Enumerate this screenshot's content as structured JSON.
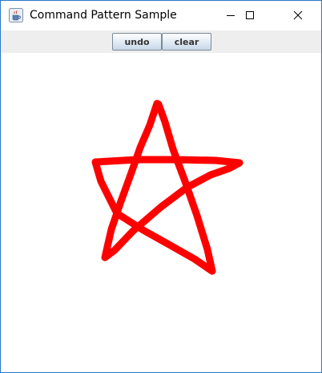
{
  "window": {
    "title": "Command Pattern Sample",
    "app_icon": "java-cup-icon",
    "controls": {
      "minimize_icon": "minimize-icon",
      "maximize_icon": "maximize-icon",
      "close_icon": "close-icon"
    }
  },
  "toolbar": {
    "undo_label": "undo",
    "clear_label": "clear"
  },
  "canvas": {
    "drawing": "star-stroke",
    "stroke_color": "#ff0000",
    "background_color": "#ffffff"
  },
  "colors": {
    "toolbar_bg": "#eeeeee",
    "window_border": "#2b78c5"
  }
}
